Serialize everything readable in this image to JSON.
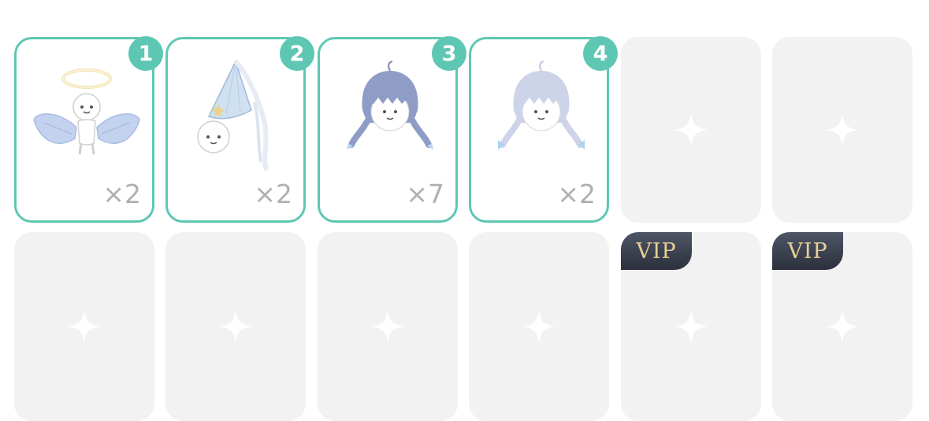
{
  "inventory": {
    "row1": [
      {
        "badge": "1",
        "count": "×2",
        "icon": "angel-wings-icon"
      },
      {
        "badge": "2",
        "count": "×2",
        "icon": "party-hat-icon"
      },
      {
        "badge": "3",
        "count": "×7",
        "icon": "twin-braids-hair-icon"
      },
      {
        "badge": "4",
        "count": "×2",
        "icon": "pale-twin-braids-hair-icon"
      }
    ],
    "vip_label": "VIP"
  },
  "colors": {
    "accent": "#5ec7b3",
    "empty_slot": "#f2f2f2",
    "vip_bg": "#2b303c",
    "vip_text": "#e8cf95"
  }
}
